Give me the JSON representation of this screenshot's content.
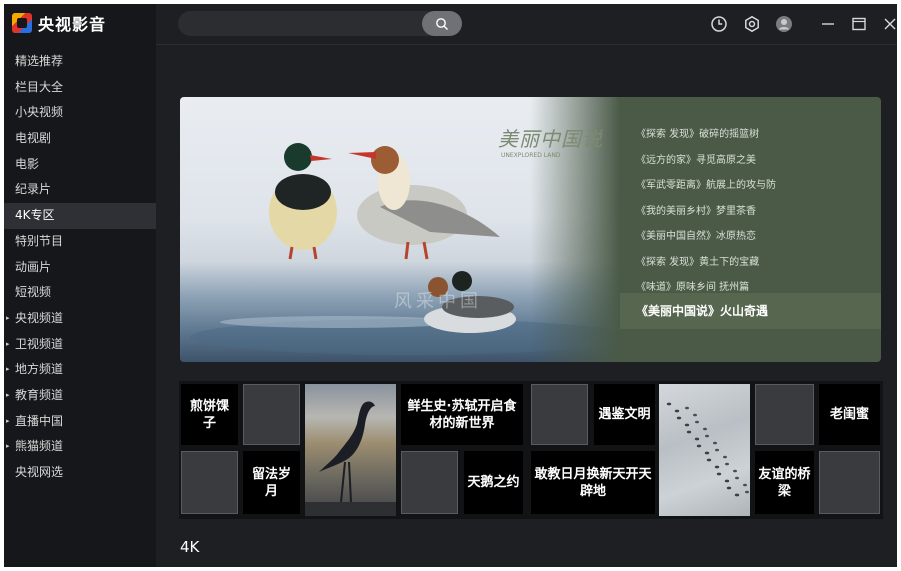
{
  "app": {
    "logo_text": "央视影音"
  },
  "sidebar": {
    "items": [
      {
        "label": "精选推荐",
        "expandable": false,
        "active": false
      },
      {
        "label": "栏目大全",
        "expandable": false,
        "active": false
      },
      {
        "label": "小央视频",
        "expandable": false,
        "active": false
      },
      {
        "label": "电视剧",
        "expandable": false,
        "active": false
      },
      {
        "label": "电影",
        "expandable": false,
        "active": false
      },
      {
        "label": "纪录片",
        "expandable": false,
        "active": false
      },
      {
        "label": "4K专区",
        "expandable": false,
        "active": true
      },
      {
        "label": "特别节目",
        "expandable": false,
        "active": false
      },
      {
        "label": "动画片",
        "expandable": false,
        "active": false
      },
      {
        "label": "短视频",
        "expandable": false,
        "active": false
      },
      {
        "label": "央视频道",
        "expandable": true,
        "active": false
      },
      {
        "label": "卫视频道",
        "expandable": true,
        "active": false
      },
      {
        "label": "地方频道",
        "expandable": true,
        "active": false
      },
      {
        "label": "教育频道",
        "expandable": true,
        "active": false
      },
      {
        "label": "直播中国",
        "expandable": true,
        "active": false
      },
      {
        "label": "熊猫频道",
        "expandable": true,
        "active": false
      },
      {
        "label": "央视网选",
        "expandable": false,
        "active": false
      }
    ]
  },
  "topbar": {
    "search_value": "",
    "icons": [
      "history-icon",
      "settings-icon",
      "avatar-icon",
      "minimize-icon",
      "maximize-icon",
      "close-icon"
    ]
  },
  "banner": {
    "wordmark": "美丽中国说",
    "wordmark_sub": "UNEXPLORED LAND",
    "watermark": "风采中国",
    "links": [
      "《探索 发现》破碎的摇篮树",
      "《远方的家》寻觅高原之美",
      "《军武零距离》航展上的攻与防",
      "《我的美丽乡村》梦里茶香",
      "《美丽中国自然》冰原热恋",
      "《探索 发现》黄土下的宝藏",
      "《味道》原味乡间 抚州篇"
    ],
    "feature": "《美丽中国说》火山奇遇"
  },
  "grid": {
    "tiles": [
      {
        "kind": "text",
        "label": "煎饼馃子"
      },
      {
        "kind": "blank",
        "label": ""
      },
      {
        "kind": "photo1",
        "label": ""
      },
      {
        "kind": "text",
        "label": "鲜生史·苏轼开启食材的新世界"
      },
      {
        "kind": "blank",
        "label": ""
      },
      {
        "kind": "text",
        "label": "遇鉴文明"
      },
      {
        "kind": "photo2",
        "label": ""
      },
      {
        "kind": "blank",
        "label": ""
      },
      {
        "kind": "text",
        "label": "老闺蜜"
      },
      {
        "kind": "blank",
        "label": ""
      },
      {
        "kind": "text",
        "label": "留法岁月"
      },
      {
        "kind": "blank",
        "label": ""
      },
      {
        "kind": "text",
        "label": "天鹅之约"
      },
      {
        "kind": "text",
        "label": "敢教日月换新天开天辟地"
      },
      {
        "kind": "text",
        "label": "友谊的桥梁"
      },
      {
        "kind": "blank",
        "label": ""
      }
    ]
  },
  "section": {
    "title": "4K"
  },
  "colors": {
    "background": "#1e1f23",
    "sidebar": "#16171a",
    "active_item": "#2e3035",
    "banner_panel": "#4a5a47"
  }
}
